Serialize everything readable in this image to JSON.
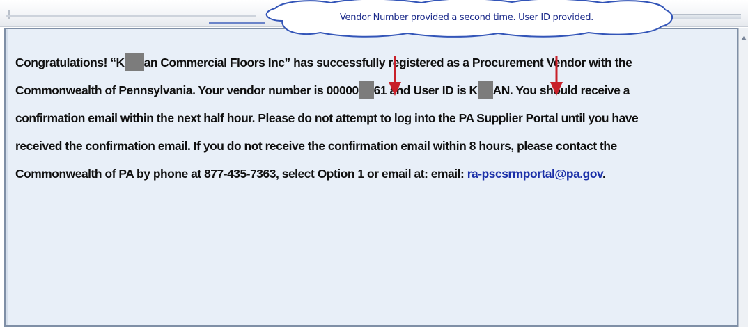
{
  "callout": {
    "text": "Vendor Number provided a second time.  User ID provided."
  },
  "message": {
    "line1_a": "Congratulations!  “K",
    "line1_b": "an Commercial Floors Inc” has successfully registered as a Procurement Vendor with the",
    "line2_a": "Commonwealth of Pennsylvania.  Your vendor number is 00000",
    "line2_b": "61  and User ID is K",
    "line2_c": "AN.  You should receive a",
    "line3": "confirmation email within the next half hour.  Please do not attempt to log into the PA Supplier Portal until you have",
    "line4": "received the confirmation email.  If you do not receive the confirmation email within 8 hours, please contact the",
    "line5_a": "Commonwealth of PA by phone at 877-435-7363,  select Option 1 or email at:  email: ",
    "email_link": "ra-pscsrmportal@pa.gov",
    "line5_b": "."
  },
  "colors": {
    "panel_bg": "#e8eff8",
    "panel_border": "#7f8fa6",
    "callout_text": "#1b2a8a",
    "arrow": "#c8202a",
    "link": "#1a2fa8"
  },
  "icons": [
    "scroll-up-arrow-icon",
    "red-pointer-arrow-icon"
  ]
}
